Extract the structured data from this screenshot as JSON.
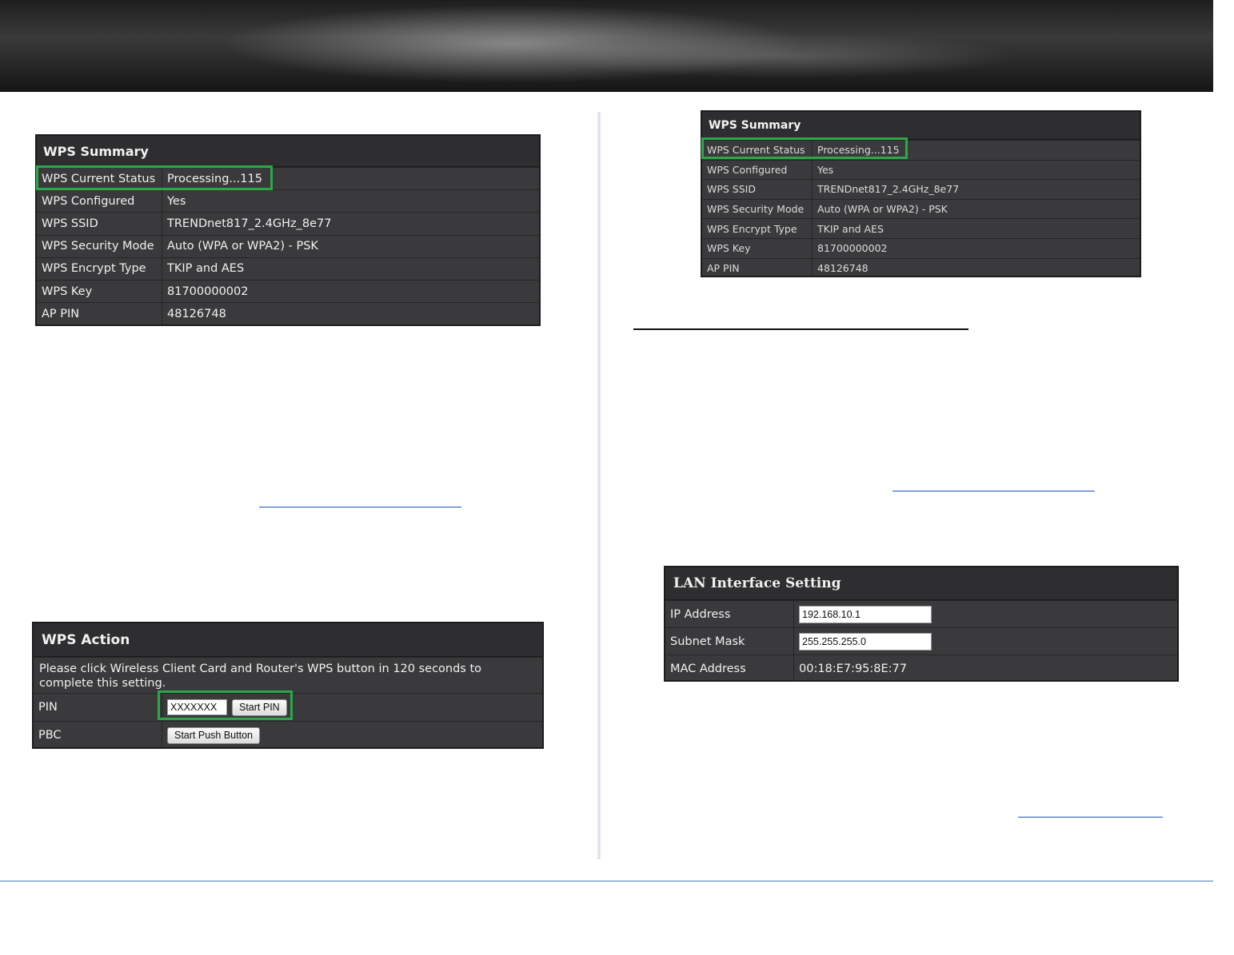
{
  "wps_summary_left": {
    "title": "WPS Summary",
    "rows": [
      {
        "label": "WPS Current Status",
        "value": "Processing...115"
      },
      {
        "label": "WPS Configured",
        "value": "Yes"
      },
      {
        "label": "WPS SSID",
        "value": "TRENDnet817_2.4GHz_8e77"
      },
      {
        "label": "WPS Security Mode",
        "value": "Auto (WPA or WPA2) - PSK"
      },
      {
        "label": "WPS Encrypt Type",
        "value": "TKIP and AES"
      },
      {
        "label": "WPS Key",
        "value": "81700000002"
      },
      {
        "label": "AP PIN",
        "value": "48126748"
      }
    ]
  },
  "wps_summary_right": {
    "title": "WPS Summary",
    "rows": [
      {
        "label": "WPS Current Status",
        "value": "Processing...115"
      },
      {
        "label": "WPS Configured",
        "value": "Yes"
      },
      {
        "label": "WPS SSID",
        "value": "TRENDnet817_2.4GHz_8e77"
      },
      {
        "label": "WPS Security Mode",
        "value": "Auto (WPA or WPA2) - PSK"
      },
      {
        "label": "WPS Encrypt Type",
        "value": "TKIP and AES"
      },
      {
        "label": "WPS Key",
        "value": "81700000002"
      },
      {
        "label": "AP PIN",
        "value": "48126748"
      }
    ]
  },
  "wps_action": {
    "title": "WPS Action",
    "message": "Please click Wireless Client Card and Router's WPS button in 120 seconds to complete this setting.",
    "pin_label": "PIN",
    "pin_value": "XXXXXXX",
    "start_pin_label": "Start PIN",
    "pbc_label": "PBC",
    "start_push_label": "Start Push Button"
  },
  "lan": {
    "title": "LAN Interface Setting",
    "ip_label": "IP Address",
    "ip_value": "192.168.10.1",
    "mask_label": "Subnet Mask",
    "mask_value": "255.255.255.0",
    "mac_label": "MAC Address",
    "mac_value": "00:18:E7:95:8E:77"
  },
  "colors": {
    "panel_bg": "#3a3a3c",
    "highlight": "#2aa84a",
    "link": "#1a56b6",
    "footer_rule": "#4a7fc1"
  }
}
